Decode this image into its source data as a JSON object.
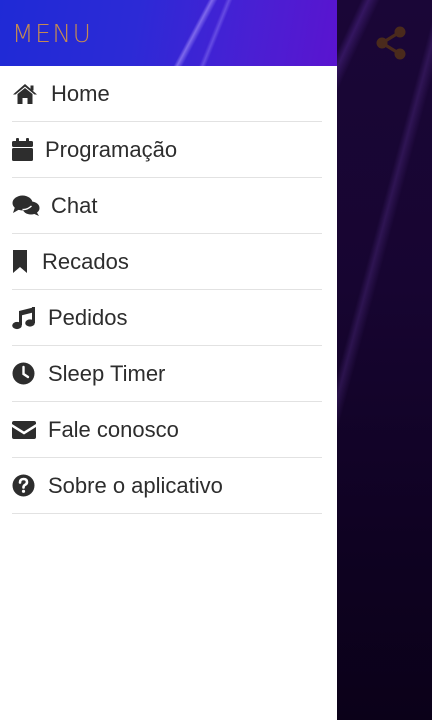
{
  "drawer": {
    "title": "MENU",
    "items": [
      {
        "label": "Home",
        "icon": "home-icon"
      },
      {
        "label": "Programação",
        "icon": "calendar-icon"
      },
      {
        "label": "Chat",
        "icon": "chat-icon"
      },
      {
        "label": "Recados",
        "icon": "bookmark-icon"
      },
      {
        "label": "Pedidos",
        "icon": "music-note-icon"
      },
      {
        "label": "Sleep Timer",
        "icon": "clock-icon"
      },
      {
        "label": "Fale conosco",
        "icon": "envelope-icon"
      },
      {
        "label": "Sobre o aplicativo",
        "icon": "question-circle-icon"
      }
    ]
  },
  "app": {
    "share_icon": "share-icon"
  },
  "colors": {
    "header_gradient_start": "#1f2ad6",
    "header_gradient_end": "#5a14cf",
    "title_color": "#c58a52",
    "drawer_bg": "#ffffff",
    "text_color": "#2d2d2d",
    "divider": "#e2e2e2",
    "background_dark": "#170531",
    "share_icon_color": "#4a2a1c"
  }
}
